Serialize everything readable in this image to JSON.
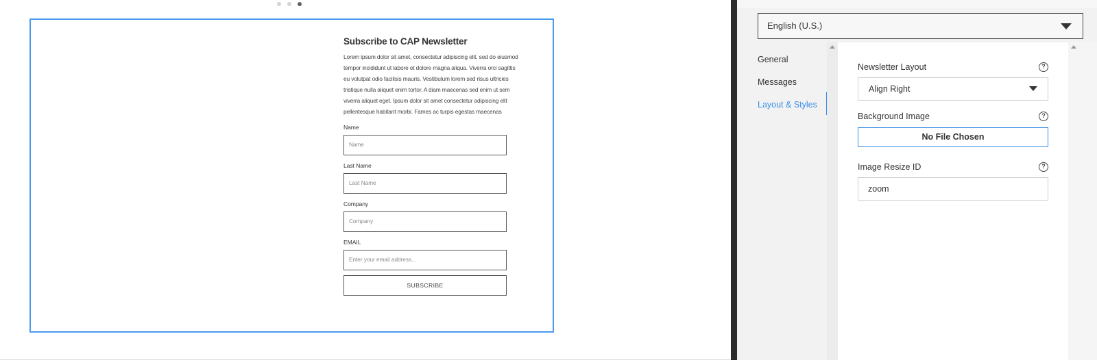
{
  "preview": {
    "title": "Subscribe to CAP Newsletter",
    "body": "Lorem ipsum dolor sit amet, consectetur adipiscing elit, sed do eiusmod tempor incididunt ut labore et dolore magna aliqua. Viverra orci sagittis eu volutpat odio facilisis mauris. Vestibulum lorem sed risus ultricies tristique nulla aliquet enim tortor. A diam maecenas sed enim ut sem viverra aliquet eget. Ipsum dolor sit amet consectetur adipiscing elit pellentesque habitant morbi. Fames ac turpis egestas maecenas",
    "fields": [
      {
        "label": "Name",
        "placeholder": "Name"
      },
      {
        "label": "Last Name",
        "placeholder": "Last Name"
      },
      {
        "label": "Company",
        "placeholder": "Company"
      },
      {
        "label": "EMAIL",
        "placeholder": "Enter your email address..."
      }
    ],
    "subscribe_label": "SUBSCRIBE",
    "carousel": {
      "count": 3,
      "active_index": 2
    }
  },
  "panel": {
    "language": "English (U.S.)",
    "nav": [
      {
        "label": "General",
        "active": false
      },
      {
        "label": "Messages",
        "active": false
      },
      {
        "label": "Layout & Styles",
        "active": true
      }
    ],
    "settings": {
      "layout_label": "Newsletter Layout",
      "layout_value": "Align Right",
      "bg_label": "Background Image",
      "bg_button": "No File Chosen",
      "resize_label": "Image Resize ID",
      "resize_value": "zoom",
      "help_glyph": "?"
    }
  },
  "colors": {
    "accent": "#3a8ee6",
    "preview_border": "#4a9bf0",
    "divider": "#2c2c2c"
  }
}
